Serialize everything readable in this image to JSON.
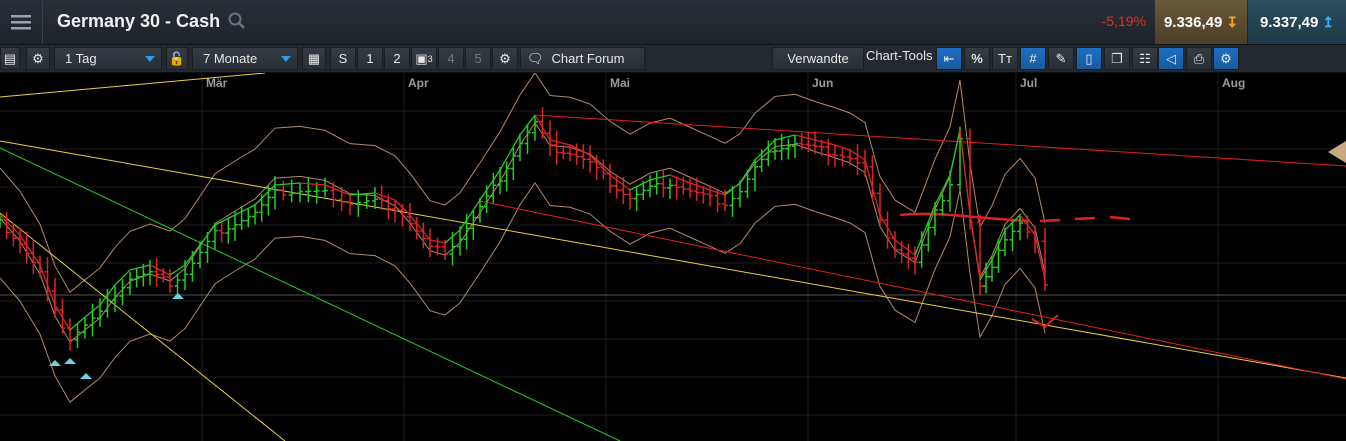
{
  "header": {
    "title": "Germany 30 - Cash",
    "change": "-5,19%",
    "sell_price": "9.336,49",
    "buy_price": "9.337,49"
  },
  "toolbar": {
    "interval": "1 Tag",
    "range": "7 Monate",
    "btn_s": "S",
    "btn_1": "1",
    "btn_2": "2",
    "btn_3_sup": "3",
    "btn_4": "4",
    "btn_5": "5",
    "chart_forum": "Chart Forum",
    "verwandte": "Verwandte",
    "chart_tools": "Chart-Tools",
    "percent": "%",
    "text_tool": "Tт"
  },
  "chart_data": {
    "type": "candlestick",
    "x_months": [
      "Mär",
      "Apr",
      "Mai",
      "Jun",
      "Jul",
      "Aug"
    ],
    "colors": {
      "up": "#22cc22",
      "down": "#dd2222",
      "trend_yellow": "#e8d040",
      "trend_green": "#22cc22",
      "trend_red": "#e02020",
      "bands": "#b08a6a",
      "grid": "#1c1c1c"
    }
  }
}
